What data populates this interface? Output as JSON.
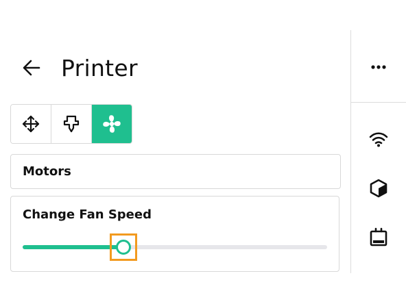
{
  "header": {
    "title": "Printer",
    "back_icon": "arrow-left-icon"
  },
  "tabs": [
    {
      "id": "move",
      "icon": "move-arrows-icon",
      "active": false
    },
    {
      "id": "extruder",
      "icon": "extruder-nozzle-icon",
      "active": false
    },
    {
      "id": "fan",
      "icon": "fan-icon",
      "active": true
    }
  ],
  "motors": {
    "label": "Motors"
  },
  "fan_speed": {
    "label": "Change Fan Speed",
    "value_percent": 33
  },
  "rail": {
    "items": [
      {
        "icon": "more-horizontal-icon"
      },
      {
        "icon": "wifi-icon"
      },
      {
        "icon": "cube-icon"
      },
      {
        "icon": "printer-device-icon"
      }
    ]
  },
  "colors": {
    "accent": "#1fbf8f",
    "highlight": "#f29a1f",
    "border": "#d8d8d8",
    "track": "#e6e6ea"
  }
}
